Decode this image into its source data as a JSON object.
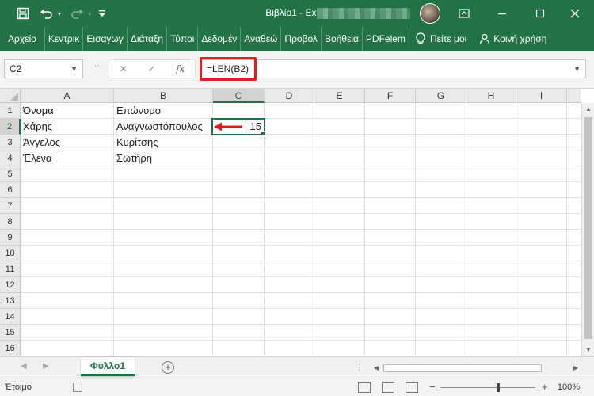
{
  "titlebar": {
    "title": "Βιβλίο1  -  Excel",
    "save_icon": "save-icon",
    "undo_icon": "undo-icon",
    "redo_icon": "redo-icon",
    "customize_icon": "customize-quick-access-icon",
    "ribbon_display_icon": "ribbon-display-options-icon",
    "minimize_icon": "minimize-icon",
    "maximize_icon": "maximize-icon",
    "close_icon": "close-icon"
  },
  "ribbon": {
    "tabs": [
      "Αρχείο",
      "Κεντρικ",
      "Εισαγωγ",
      "Διάταξη",
      "Τύποι",
      "Δεδομέν",
      "Αναθεώ",
      "Προβολ",
      "Βοήθεια",
      "PDFelem"
    ],
    "tell_me": "Πείτε μοι",
    "share": "Κοινή χρήση"
  },
  "formula_bar": {
    "name_box": "C2",
    "cancel_glyph": "✕",
    "enter_glyph": "✓",
    "fx_label": "fx",
    "formula": "=LEN(B2)"
  },
  "grid": {
    "columns": [
      "A",
      "B",
      "C",
      "D",
      "E",
      "F",
      "G",
      "H",
      "I"
    ],
    "active_column": "C",
    "rows": [
      "1",
      "2",
      "3",
      "4",
      "5",
      "6",
      "7",
      "8",
      "9",
      "10",
      "11",
      "12",
      "13",
      "14",
      "15",
      "16"
    ],
    "active_row": "2",
    "cells": {
      "A1": "Όνομα",
      "B1": "Επώνυμο",
      "A2": "Χάρης",
      "B2": "Αναγνωστόπουλος",
      "C2": "15",
      "A3": "Άγγελος",
      "B3": "Κυρίτσης",
      "A4": "Έλενα",
      "B4": "Σωτήρη"
    },
    "selected_cell": "C2",
    "annotation_color": "#e02020"
  },
  "sheets": {
    "tabs": [
      "Φύλλο1"
    ],
    "add_glyph": "+"
  },
  "statusbar": {
    "ready": "Έτοιμο",
    "zoom_minus": "−",
    "zoom_plus": "+",
    "zoom": "100%"
  },
  "colors": {
    "brand": "#217346",
    "highlight": "#e02020"
  }
}
